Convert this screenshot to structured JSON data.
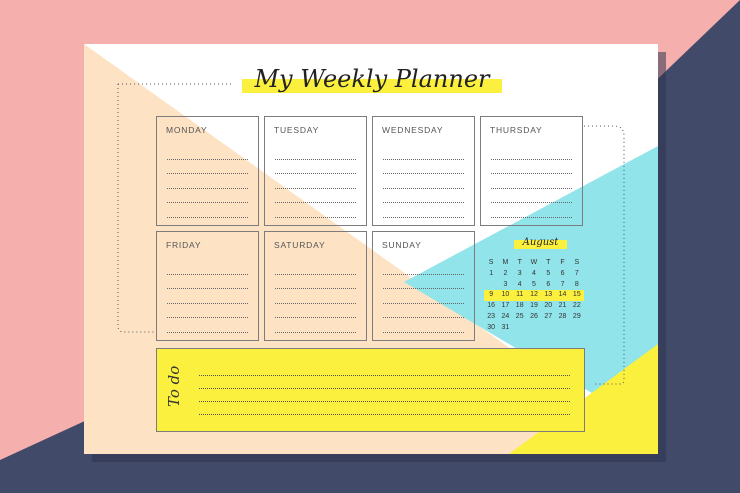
{
  "colors": {
    "pink": "#f5b0ad",
    "navy": "#424a6a",
    "peach": "#fde3c4",
    "cyan": "#91e4e9",
    "yellow": "#fbf03d",
    "white": "#ffffff"
  },
  "planner": {
    "title": "My Weekly Planner",
    "todo_label": "To do"
  },
  "days": [
    {
      "label": "MONDAY"
    },
    {
      "label": "TUESDAY"
    },
    {
      "label": "WEDNESDAY"
    },
    {
      "label": "THURSDAY"
    },
    {
      "label": "FRIDAY"
    },
    {
      "label": "SATURDAY"
    },
    {
      "label": "SUNDAY"
    }
  ],
  "calendar": {
    "month": "August",
    "weekdays": [
      "S",
      "M",
      "T",
      "W",
      "T",
      "F",
      "S"
    ],
    "weeks": [
      [
        "1",
        "2",
        "3",
        "4",
        "5",
        "6",
        "7"
      ],
      [
        "",
        "3",
        "4",
        "5",
        "6",
        "7",
        "8"
      ],
      [
        "9",
        "10",
        "11",
        "12",
        "13",
        "14",
        "15"
      ],
      [
        "16",
        "17",
        "18",
        "19",
        "20",
        "21",
        "22"
      ],
      [
        "23",
        "24",
        "25",
        "26",
        "27",
        "28",
        "29"
      ],
      [
        "30",
        "31",
        "",
        "",
        "",
        "",
        ""
      ]
    ],
    "highlighted_week": 2
  }
}
